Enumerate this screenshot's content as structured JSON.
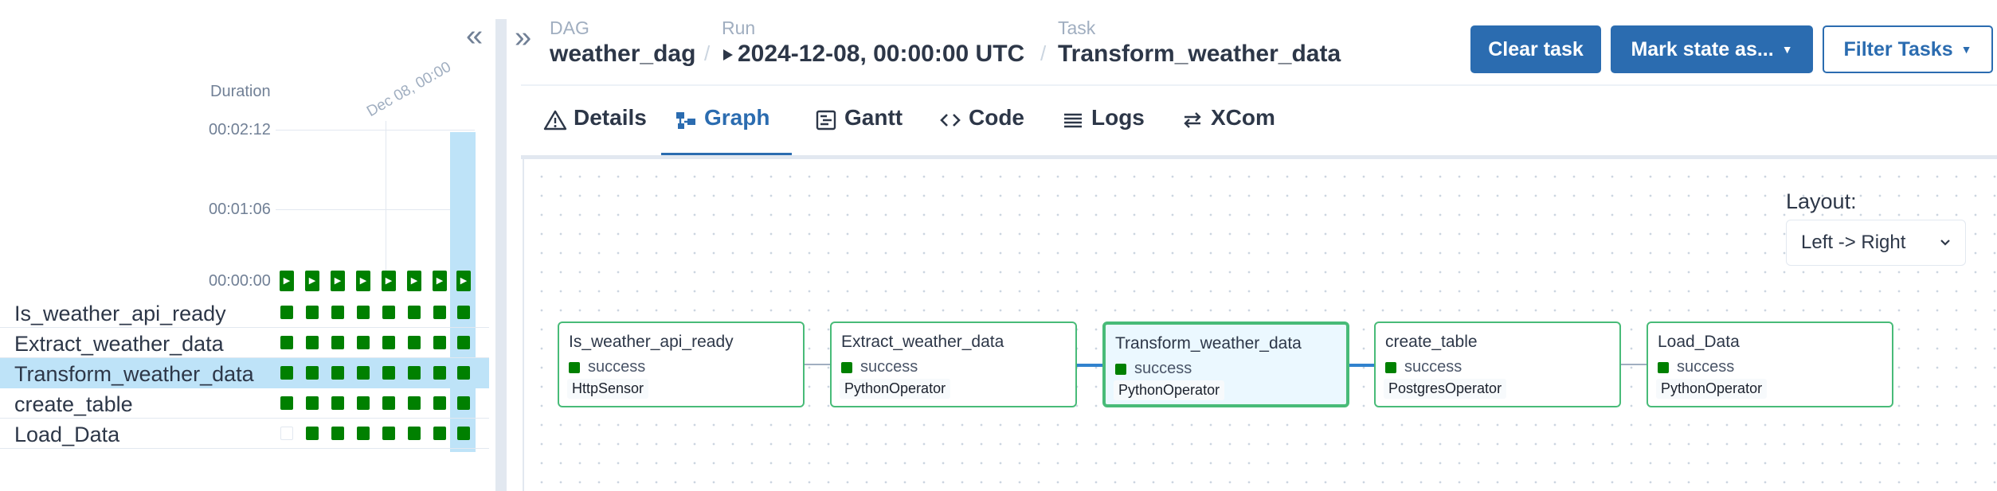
{
  "grid": {
    "duration_label": "Duration",
    "date_label": "Dec 08, 00:00",
    "y_ticks": [
      "00:02:12",
      "00:01:06",
      "00:00:00"
    ],
    "run_count": 8,
    "selected_run_index": 7,
    "tasks": [
      {
        "label": "Is_weather_api_ready",
        "cells": [
          "success",
          "success",
          "success",
          "success",
          "success",
          "success",
          "success",
          "success"
        ],
        "selected": false
      },
      {
        "label": "Extract_weather_data",
        "cells": [
          "success",
          "success",
          "success",
          "success",
          "success",
          "success",
          "success",
          "success"
        ],
        "selected": false
      },
      {
        "label": "Transform_weather_data",
        "cells": [
          "success",
          "success",
          "success",
          "success",
          "success",
          "success",
          "success",
          "success"
        ],
        "selected": true
      },
      {
        "label": "create_table",
        "cells": [
          "success",
          "success",
          "success",
          "success",
          "success",
          "success",
          "success",
          "success"
        ],
        "selected": false
      },
      {
        "label": "Load_Data",
        "cells": [
          "none",
          "success",
          "success",
          "success",
          "success",
          "success",
          "success",
          "success"
        ],
        "selected": false
      }
    ],
    "status_colors": {
      "success": "#008000",
      "none": "#ffffff"
    }
  },
  "breadcrumb": {
    "dag_label": "DAG",
    "dag_value": "weather_dag",
    "run_label": "Run",
    "run_value": "2024-12-08, 00:00:00 UTC",
    "task_label": "Task",
    "task_value": "Transform_weather_data",
    "separator": "/"
  },
  "actions": {
    "clear_task": "Clear task",
    "mark_state": "Mark state as...",
    "filter_tasks": "Filter Tasks"
  },
  "tabs": [
    {
      "label": "Details",
      "icon": "warning-icon",
      "active": false
    },
    {
      "label": "Graph",
      "icon": "graph-icon",
      "active": true
    },
    {
      "label": "Gantt",
      "icon": "gantt-icon",
      "active": false
    },
    {
      "label": "Code",
      "icon": "code-icon",
      "active": false
    },
    {
      "label": "Logs",
      "icon": "logs-icon",
      "active": false
    },
    {
      "label": "XCom",
      "icon": "xcom-icon",
      "active": false
    }
  ],
  "graph": {
    "layout_label": "Layout:",
    "layout_value": "Left -> Right",
    "nodes": [
      {
        "name": "Is_weather_api_ready",
        "state": "success",
        "operator": "HttpSensor",
        "selected": false
      },
      {
        "name": "Extract_weather_data",
        "state": "success",
        "operator": "PythonOperator",
        "selected": false
      },
      {
        "name": "Transform_weather_data",
        "state": "success",
        "operator": "PythonOperator",
        "selected": true
      },
      {
        "name": "create_table",
        "state": "success",
        "operator": "PostgresOperator",
        "selected": false
      },
      {
        "name": "Load_Data",
        "state": "success",
        "operator": "PythonOperator",
        "selected": false
      }
    ]
  },
  "colors": {
    "accent": "#2b6cb0",
    "success": "#008000",
    "node_border": "#48bb78",
    "selected_bg": "#bee3f8"
  }
}
